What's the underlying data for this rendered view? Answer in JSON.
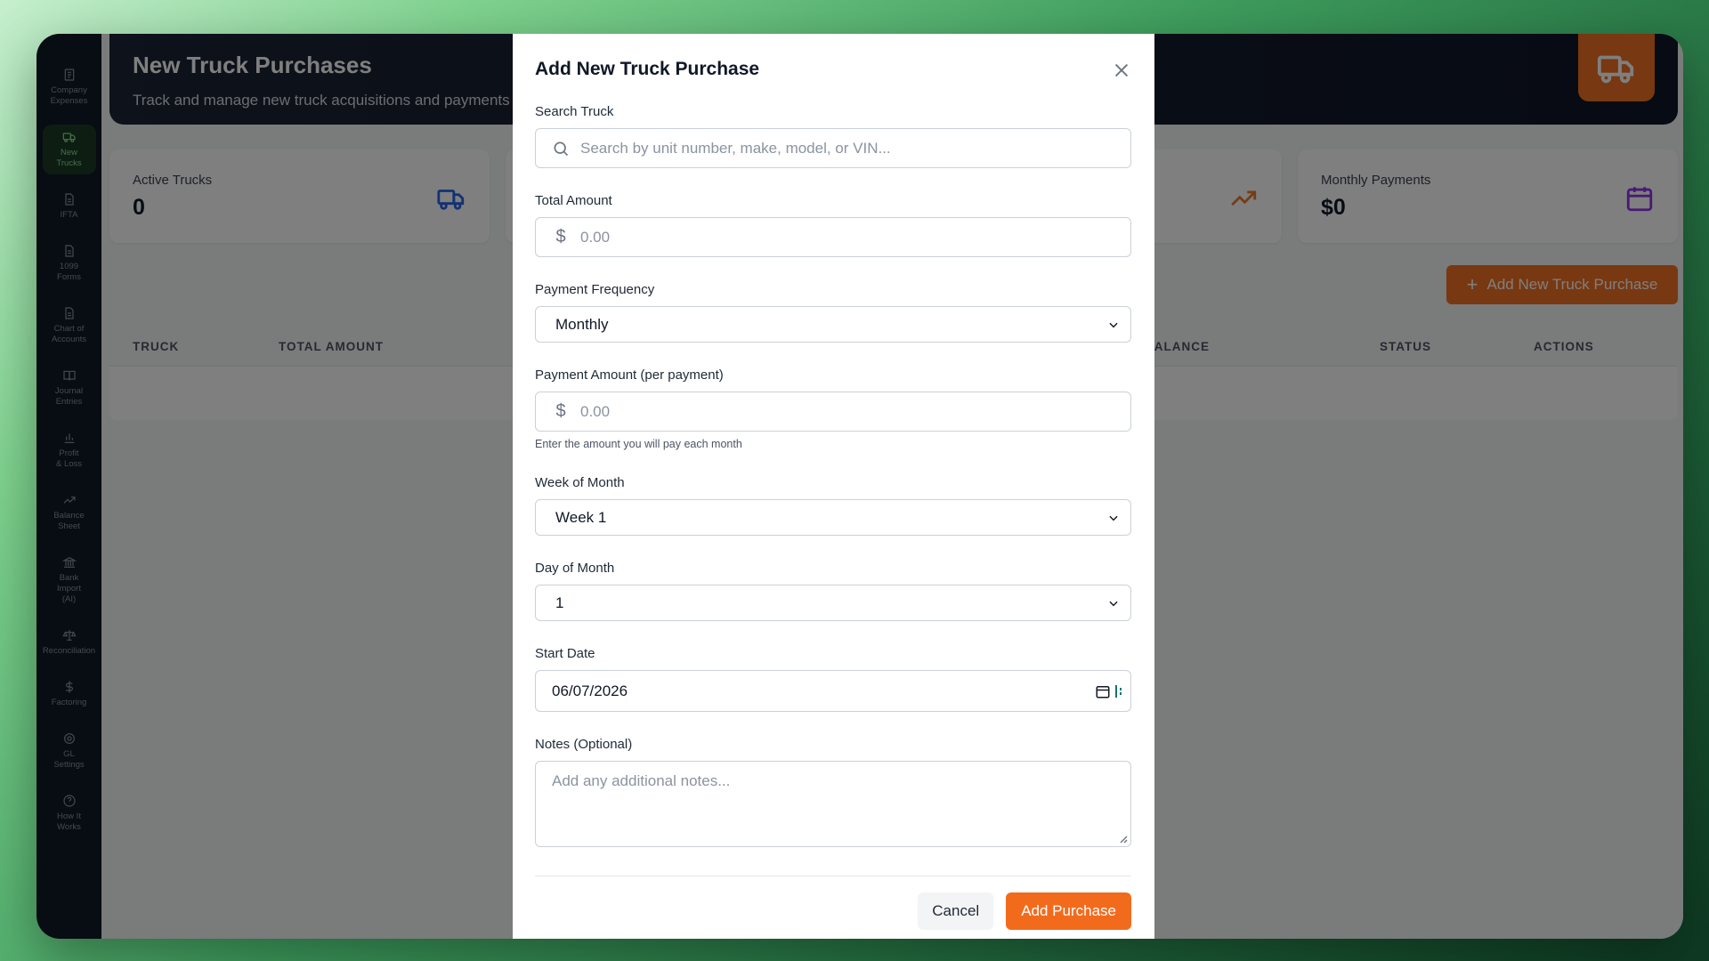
{
  "sidebar": {
    "items": [
      {
        "label": "Company\nExpenses",
        "icon": "receipt-icon",
        "active": false
      },
      {
        "label": "New\nTrucks",
        "icon": "truck-icon",
        "active": true
      },
      {
        "label": "IFTA",
        "icon": "document-icon",
        "active": false
      },
      {
        "label": "1099\nForms",
        "icon": "document-icon",
        "active": false
      },
      {
        "label": "Chart of\nAccounts",
        "icon": "document-icon",
        "active": false
      },
      {
        "label": "Journal\nEntries",
        "icon": "book-icon",
        "active": false
      },
      {
        "label": "Profit\n& Loss",
        "icon": "bar-chart-icon",
        "active": false
      },
      {
        "label": "Balance\nSheet",
        "icon": "trending-up-icon",
        "active": false
      },
      {
        "label": "Bank\nImport\n(AI)",
        "icon": "bank-icon",
        "active": false
      },
      {
        "label": "Reconciliation",
        "icon": "scale-icon",
        "active": false
      },
      {
        "label": "Factoring",
        "icon": "dollar-icon",
        "active": false
      },
      {
        "label": "GL\nSettings",
        "icon": "gear-icon",
        "active": false
      },
      {
        "label": "How It\nWorks",
        "icon": "help-icon",
        "active": false
      }
    ]
  },
  "header": {
    "title": "New Truck Purchases",
    "subtitle": "Track and manage new truck acquisitions and payments"
  },
  "stats": [
    {
      "label": "Active Trucks",
      "value": "0",
      "icon": "truck-icon",
      "color": "#2563eb"
    },
    {
      "label": "",
      "value": "",
      "icon": "",
      "color": ""
    },
    {
      "label": "",
      "value": "",
      "icon": "trending-up-icon",
      "color": "#ea7a2c"
    },
    {
      "label": "Monthly Payments",
      "value": "$0",
      "icon": "calendar-icon",
      "color": "#9333ea"
    }
  ],
  "toolbar": {
    "add_label": "Add New Truck Purchase"
  },
  "table": {
    "columns": [
      "TRUCK",
      "TOTAL AMOUNT",
      "BALANCE",
      "STATUS",
      "ACTIONS"
    ]
  },
  "modal": {
    "title": "Add New Truck Purchase",
    "search": {
      "label": "Search Truck",
      "placeholder": "Search by unit number, make, model, or VIN..."
    },
    "total_amount": {
      "label": "Total Amount",
      "prefix": "$",
      "placeholder": "0.00"
    },
    "payment_frequency": {
      "label": "Payment Frequency",
      "value": "Monthly"
    },
    "payment_amount": {
      "label": "Payment Amount (per payment)",
      "prefix": "$",
      "placeholder": "0.00",
      "helper": "Enter the amount you will pay each month"
    },
    "week_of_month": {
      "label": "Week of Month",
      "value": "Week 1"
    },
    "day_of_month": {
      "label": "Day of Month",
      "value": "1"
    },
    "start_date": {
      "label": "Start Date",
      "value": "06/07/2026"
    },
    "notes": {
      "label": "Notes (Optional)",
      "placeholder": "Add any additional notes..."
    },
    "cancel_label": "Cancel",
    "submit_label": "Add Purchase",
    "accent": "#f26b1d"
  }
}
